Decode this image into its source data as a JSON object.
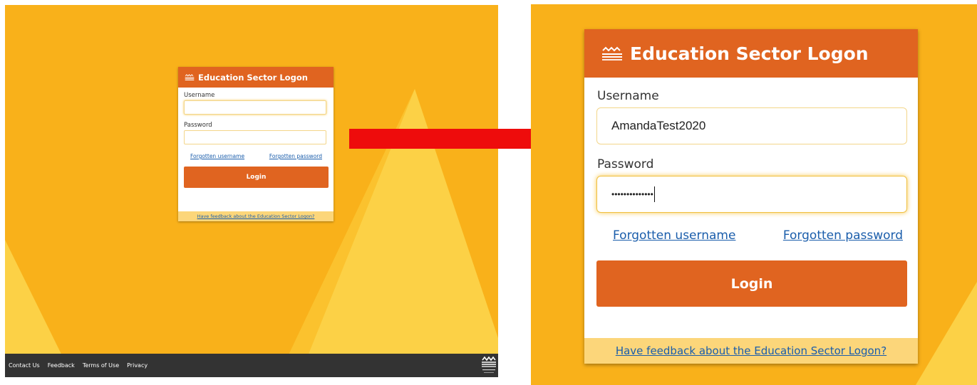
{
  "colors": {
    "background": "#f9b11a",
    "triangle_light": "#fcd146",
    "triangle_mid": "#fbc22e",
    "header": "#e06420",
    "button": "#e06420",
    "feedback_bar": "#fcd67a",
    "link": "#1a5dab",
    "footer": "#333333",
    "arrow": "#ee0c0c"
  },
  "icons": {
    "header_logo": "waves-icon",
    "ministry_logo": "ministry-waves-icon",
    "arrow": "right-arrow"
  },
  "before": {
    "title": "Education Sector Logon",
    "username_label": "Username",
    "username_value": "",
    "password_label": "Password",
    "password_value": "",
    "forgotten_username": "Forgotten username",
    "forgotten_password": "Forgotten password",
    "login_button": "Login",
    "feedback_link": "Have feedback about the Education Sector Logon?"
  },
  "footer": {
    "links": [
      "Contact Us",
      "Feedback",
      "Terms of Use",
      "Privacy"
    ]
  },
  "after": {
    "title": "Education Sector Logon",
    "username_label": "Username",
    "username_value": "AmandaTest2020",
    "password_label": "Password",
    "password_value": "••••••••••••••",
    "forgotten_username": "Forgotten username",
    "forgotten_password": "Forgotten password",
    "login_button": "Login",
    "feedback_link": "Have feedback about the Education Sector Logon?"
  }
}
